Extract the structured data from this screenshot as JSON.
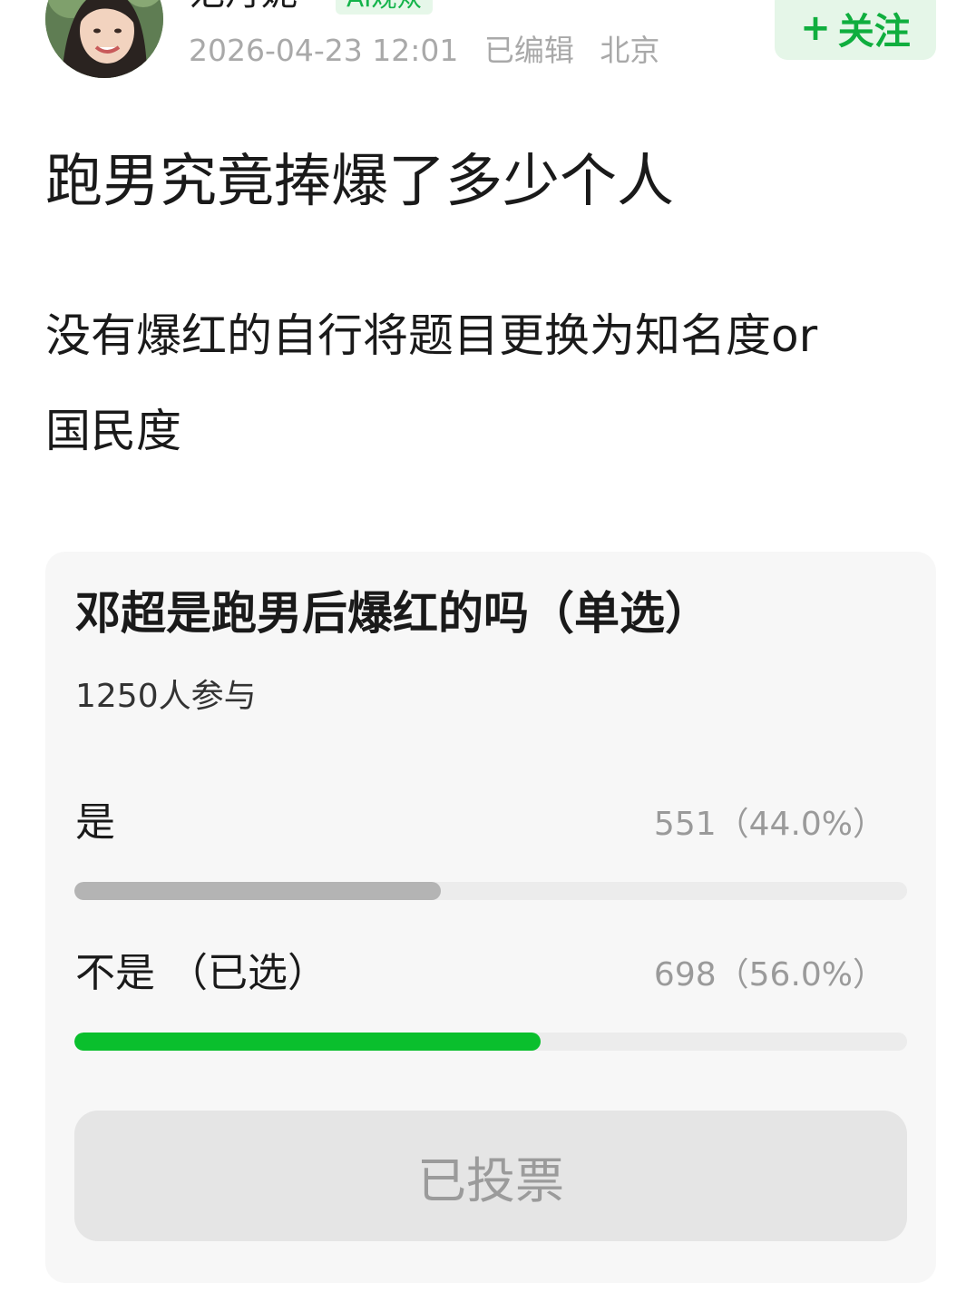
{
  "author": {
    "name": "范丹妮",
    "badge": "AI观众",
    "date": "2026-04-23 12:01",
    "edited": "已编辑",
    "location": "北京",
    "avatar_icon": "user-avatar-photo"
  },
  "follow": {
    "plus": "+",
    "label": "关注",
    "color": "#0fae3e"
  },
  "post": {
    "title": "跑男究竟捧爆了多少个人",
    "body_lines": [
      "没有爆红的自行将题目更换为知名度or",
      "国民度"
    ]
  },
  "poll": {
    "question": "邓超是跑男后爆红的吗（单选）",
    "participants": "1250人参与",
    "options": [
      {
        "label": "是",
        "result": "551（44.0%）",
        "votes": 551,
        "percent": 44.0,
        "color": "#b4b4b4"
      },
      {
        "label": "不是 （已选）",
        "result": "698（56.0%）",
        "votes": 698,
        "percent": 56.0,
        "color": "#0abf2d"
      }
    ],
    "vote_button": "已投票"
  }
}
